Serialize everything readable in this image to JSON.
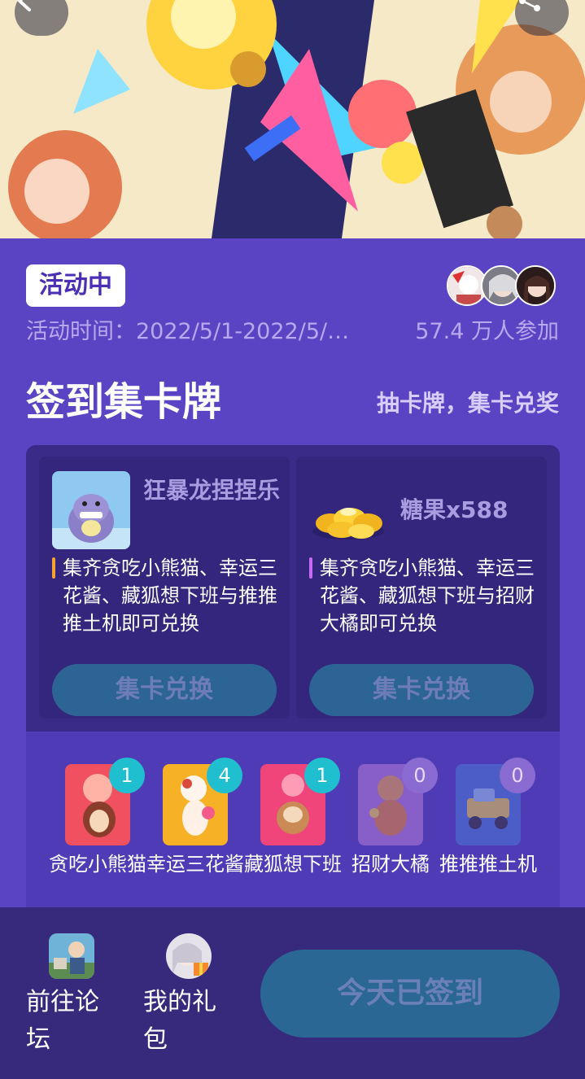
{
  "status_badge": "活动中",
  "activity_time": "活动时间：2022/5/1-2022/5/…",
  "participants": "57.4 万人参加",
  "section": {
    "title": "签到集卡牌",
    "subtitle": "抽卡牌，集卡兑奖"
  },
  "rewards": [
    {
      "name": "狂暴龙捏捏乐",
      "description": "集齐贪吃小熊猫、幸运三花酱、藏狐想下班与推推推土机即可兑换",
      "button": "集卡兑换"
    },
    {
      "name": "糖果x588",
      "description": "集齐贪吃小熊猫、幸运三花酱、藏狐想下班与招财大橘即可兑换",
      "button": "集卡兑换"
    }
  ],
  "cards": [
    {
      "name": "贪吃小熊猫",
      "count": "1"
    },
    {
      "name": "幸运三花酱",
      "count": "4"
    },
    {
      "name": "藏狐想下班",
      "count": "1"
    },
    {
      "name": "招财大橘",
      "count": "0"
    },
    {
      "name": "推推推土机",
      "count": "0"
    }
  ],
  "bottom": {
    "forum_label": "前往论坛",
    "gifts_label": "我的礼包",
    "signed_button": "今天已签到"
  },
  "colors": {
    "background": "#5b44c4",
    "badge_text": "#4b2fb5",
    "button_disabled": "#2c6595",
    "count_active": "#1fbfcf",
    "count_zero": "#8a6bd1"
  }
}
